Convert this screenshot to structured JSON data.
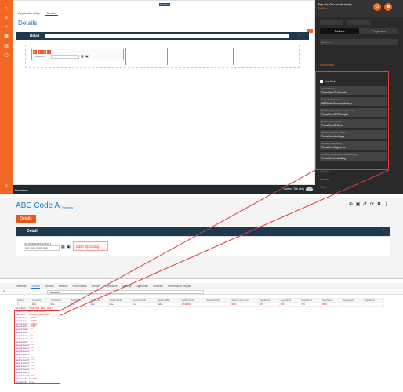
{
  "designer": {
    "left_rail_icons": [
      "home-icon",
      "layers-icon",
      "chart-icon",
      "table-icon",
      "document-icon",
      "page-icon",
      "help-icon"
    ],
    "tabs": [
      "Application Map",
      "Details"
    ],
    "page_title": "Details",
    "top_badge": "Sections",
    "detail_bar": {
      "label": "Detail",
      "chevron": "‹"
    },
    "field": {
      "label": "Account",
      "buttons": [
        "1",
        "2",
        "3",
        "4"
      ]
    },
    "status_bar": {
      "problems": "Problems",
      "toggle_label": "Current Tab Only",
      "toggle_on": false
    }
  },
  "right_panel": {
    "title": "Top ch_Occ-conf-entry",
    "subtitle": "Stefflon",
    "tabs": [
      "Toolbox",
      "Properties"
    ],
    "active_tab": "Toolbox",
    "search_placeholder": "Search...",
    "sections": [
      "Properties",
      "Layout",
      "Events",
      "Style",
      "Validation"
    ],
    "key_field_label": "Key Field",
    "properties": [
      {
        "label": "Field Binding",
        "value": "TransView.GLAccount"
      },
      {
        "label": "Code Field Column",
        "value": "ABCCode.CurrencyCode_c"
      },
      {
        "label": "Binding (Selected Component)",
        "value": "TransView.GXTCompID"
      },
      {
        "label": "Binding (Description)",
        "value": "TransView.GLDesc"
      },
      {
        "label": "Binding (Account Seg)",
        "value": "TransView.AcctSegs"
      },
      {
        "label": "Binding (Segments)",
        "value": "TransView.Segments"
      },
      {
        "label": "Binding (Invalid Account Message)",
        "value": "TransView.InvalidMsg"
      }
    ]
  },
  "preview": {
    "title": "ABC Code A",
    "badge": "Preview",
    "details_button": "Details",
    "detail_bar": {
      "label": "Detail",
      "chevron": "‹"
    },
    "field_label": "erp-gl-account-editor-1",
    "field_value": "001-000-0001-000",
    "cash_text": "Cash Operating",
    "toolbar_icons": [
      "add-icon",
      "save-icon",
      "undo-icon",
      "refresh-icon",
      "delete-icon",
      "more-icon"
    ]
  },
  "devtools": {
    "tabs": [
      "Elements",
      "Console",
      "Sources",
      "Network",
      "Performance",
      "Memory",
      "Application",
      "Security",
      "Lighthouse",
      "Recorder",
      "Performance insights"
    ],
    "active_tab": "Console",
    "filter_text": "TransView",
    "table_headers": [
      "(index)",
      "Company",
      "SysRowID",
      "SysRevID",
      "AcctDesc",
      "SysRevHold",
      "SysCurrCode",
      "SysRowMap",
      "SysRevCode",
      "SysActivityNo",
      "SysCompAccount",
      "SegValue1",
      "SegValue2",
      "SegValue3",
      "SegValue4",
      "SegValue5",
      "SegValue6"
    ],
    "table_row": [
      "0",
      "ABC",
      "true",
      "true",
      "true",
      "true",
      "true",
      "false",
      "CASHOp",
      "",
      "0001",
      "000",
      "000",
      "001",
      "0001",
      "",
      ""
    ],
    "object_lines": [
      {
        "k": "AcctDesc",
        "v": "\"001-000-0001-000\""
      },
      {
        "k": "GLAcct",
        "v": "\"Cash Operating\""
      },
      {
        "k": "CBLAcct",
        "v": "\"001|000|0001|000\""
      },
      {
        "k": "SegValue1",
        "v": "\"001\""
      },
      {
        "k": "SegValue2",
        "v": "\"000\""
      },
      {
        "k": "SegValue3",
        "v": "\"0001\""
      },
      {
        "k": "SegValue4",
        "v": "\"000\""
      },
      {
        "k": "SegValue5",
        "v": "\"\""
      },
      {
        "k": "SegValue6",
        "v": "\"\""
      },
      {
        "k": "SegValue7",
        "v": "\"\""
      },
      {
        "k": "SegValue8",
        "v": "\"\""
      },
      {
        "k": "SegValue9",
        "v": "\"\""
      },
      {
        "k": "SegValue10",
        "v": "\"\""
      },
      {
        "k": "SegValue11",
        "v": "\"\""
      },
      {
        "k": "SegValue12",
        "v": "\"\""
      },
      {
        "k": "SegValue13",
        "v": "\"\""
      },
      {
        "k": "SegValue14",
        "v": "\"\""
      },
      {
        "k": "SegValue15",
        "v": "\"\""
      },
      {
        "k": "SegValue16",
        "v": "\"\""
      },
      {
        "k": "SegValue17",
        "v": "\"\""
      },
      {
        "k": "SegValue18",
        "v": "\"\""
      },
      {
        "k": "SegValue19",
        "v": "\"\""
      },
      {
        "k": "SegValue20",
        "v": "\"\""
      },
      {
        "k": "SysRowID",
        "v": "\"a1b2\""
      },
      {
        "k": "SysRevID",
        "v": "true"
      }
    ]
  },
  "colors": {
    "brand": "#f26722",
    "header_dark": "#1f3a4f",
    "link": "#1c7cc0",
    "highlight": "#e53935"
  }
}
